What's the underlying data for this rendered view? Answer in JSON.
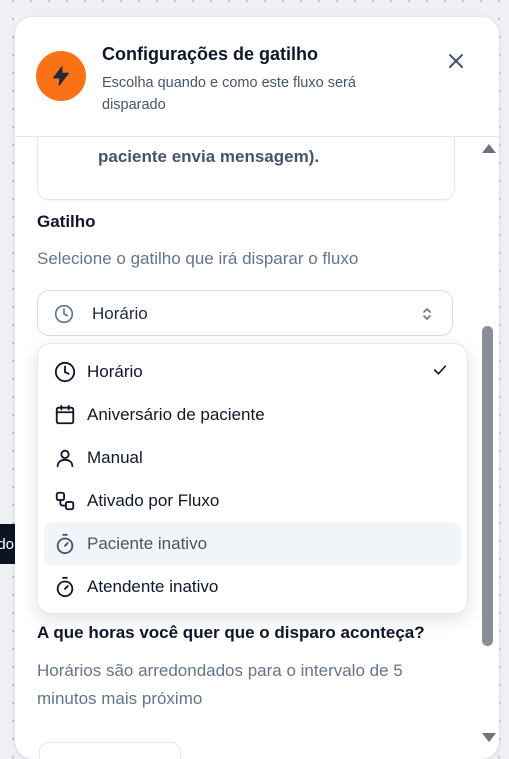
{
  "header": {
    "title": "Configurações de gatilho",
    "subtitle": "Escolha quando e como este fluxo será disparado"
  },
  "info_card": {
    "text": "paciente envia mensagem)."
  },
  "trigger": {
    "label": "Gatilho",
    "description": "Selecione o gatilho que irá disparar o fluxo",
    "selected": "Horário"
  },
  "dropdown": {
    "options": [
      {
        "label": "Horário",
        "icon": "clock-icon",
        "selected": true
      },
      {
        "label": "Aniversário de paciente",
        "icon": "calendar-icon"
      },
      {
        "label": "Manual",
        "icon": "user-icon"
      },
      {
        "label": "Ativado por Fluxo",
        "icon": "workflow-icon"
      },
      {
        "label": "Paciente inativo",
        "icon": "timer-icon",
        "highlighted": true
      },
      {
        "label": "Atendente inativo",
        "icon": "timer-icon"
      }
    ]
  },
  "schedule": {
    "question": "A que horas você quer que o disparo aconteça?",
    "hint": "Horários são arredondados para o intervalo de 5 minutos mais próximo"
  },
  "tooltip": {
    "text": "do"
  },
  "colors": {
    "accent": "#f97316",
    "highlight": "#f1f5f9",
    "muted_text": "#64748b"
  }
}
